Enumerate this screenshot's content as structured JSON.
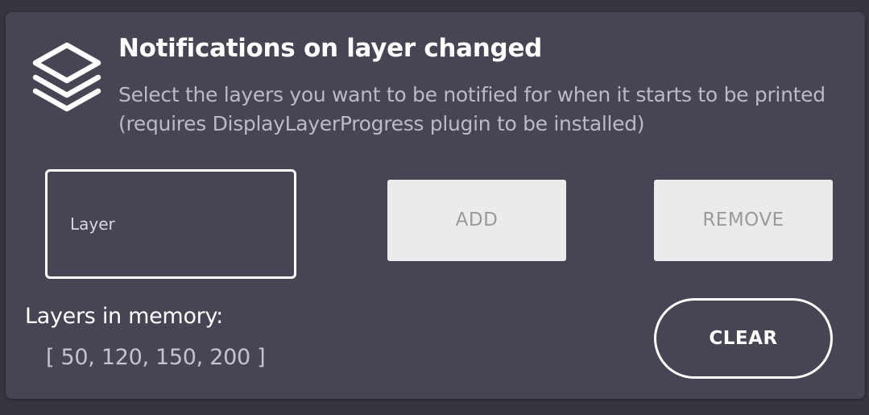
{
  "header": {
    "title": "Notifications on layer changed",
    "description": "Select the layers you want to be notified for when it starts to be printed (requires DisplayLayerProgress plugin to be installed)",
    "icon": "layers-icon"
  },
  "layer_input": {
    "placeholder": "Layer",
    "value": ""
  },
  "buttons": {
    "add_label": "ADD",
    "remove_label": "REMOVE",
    "clear_label": "CLEAR"
  },
  "memory": {
    "label": "Layers in memory:",
    "values_text": "[ 50, 120, 150, 200 ]",
    "values": [
      50,
      120,
      150,
      200
    ]
  },
  "colors": {
    "background": "#36343f",
    "card": "#474553",
    "text_primary": "#ffffff",
    "text_secondary": "#bcbac4",
    "button_disabled_bg": "#ebebeb",
    "button_disabled_text": "#9a9a9a"
  }
}
